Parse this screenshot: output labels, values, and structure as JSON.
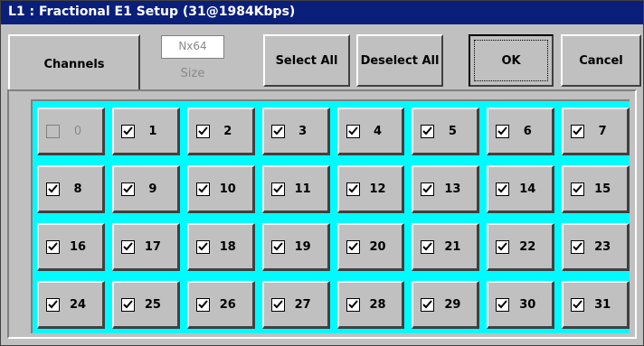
{
  "window": {
    "title": "L1 : Fractional E1 Setup (31@1984Kbps)"
  },
  "toolbar": {
    "tab_label": "Channels",
    "size_value": "Nx64",
    "size_label": "Size",
    "select_all": "Select All",
    "deselect_all": "Deselect All",
    "ok": "OK",
    "cancel": "Cancel"
  },
  "channels": [
    {
      "label": "0",
      "checked": false,
      "enabled": false
    },
    {
      "label": "1",
      "checked": true,
      "enabled": true
    },
    {
      "label": "2",
      "checked": true,
      "enabled": true
    },
    {
      "label": "3",
      "checked": true,
      "enabled": true
    },
    {
      "label": "4",
      "checked": true,
      "enabled": true
    },
    {
      "label": "5",
      "checked": true,
      "enabled": true
    },
    {
      "label": "6",
      "checked": true,
      "enabled": true
    },
    {
      "label": "7",
      "checked": true,
      "enabled": true
    },
    {
      "label": "8",
      "checked": true,
      "enabled": true
    },
    {
      "label": "9",
      "checked": true,
      "enabled": true
    },
    {
      "label": "10",
      "checked": true,
      "enabled": true
    },
    {
      "label": "11",
      "checked": true,
      "enabled": true
    },
    {
      "label": "12",
      "checked": true,
      "enabled": true
    },
    {
      "label": "13",
      "checked": true,
      "enabled": true
    },
    {
      "label": "14",
      "checked": true,
      "enabled": true
    },
    {
      "label": "15",
      "checked": true,
      "enabled": true
    },
    {
      "label": "16",
      "checked": true,
      "enabled": true
    },
    {
      "label": "17",
      "checked": true,
      "enabled": true
    },
    {
      "label": "18",
      "checked": true,
      "enabled": true
    },
    {
      "label": "19",
      "checked": true,
      "enabled": true
    },
    {
      "label": "20",
      "checked": true,
      "enabled": true
    },
    {
      "label": "21",
      "checked": true,
      "enabled": true
    },
    {
      "label": "22",
      "checked": true,
      "enabled": true
    },
    {
      "label": "23",
      "checked": true,
      "enabled": true
    },
    {
      "label": "24",
      "checked": true,
      "enabled": true
    },
    {
      "label": "25",
      "checked": true,
      "enabled": true
    },
    {
      "label": "26",
      "checked": true,
      "enabled": true
    },
    {
      "label": "27",
      "checked": true,
      "enabled": true
    },
    {
      "label": "28",
      "checked": true,
      "enabled": true
    },
    {
      "label": "29",
      "checked": true,
      "enabled": true
    },
    {
      "label": "30",
      "checked": true,
      "enabled": true
    },
    {
      "label": "31",
      "checked": true,
      "enabled": true
    }
  ],
  "colors": {
    "titlebar": "#0a1f7a",
    "grid_background": "#00fbff",
    "face": "#c0c0c0"
  },
  "icons": {
    "checkbox_mark": "checkmark-icon"
  }
}
